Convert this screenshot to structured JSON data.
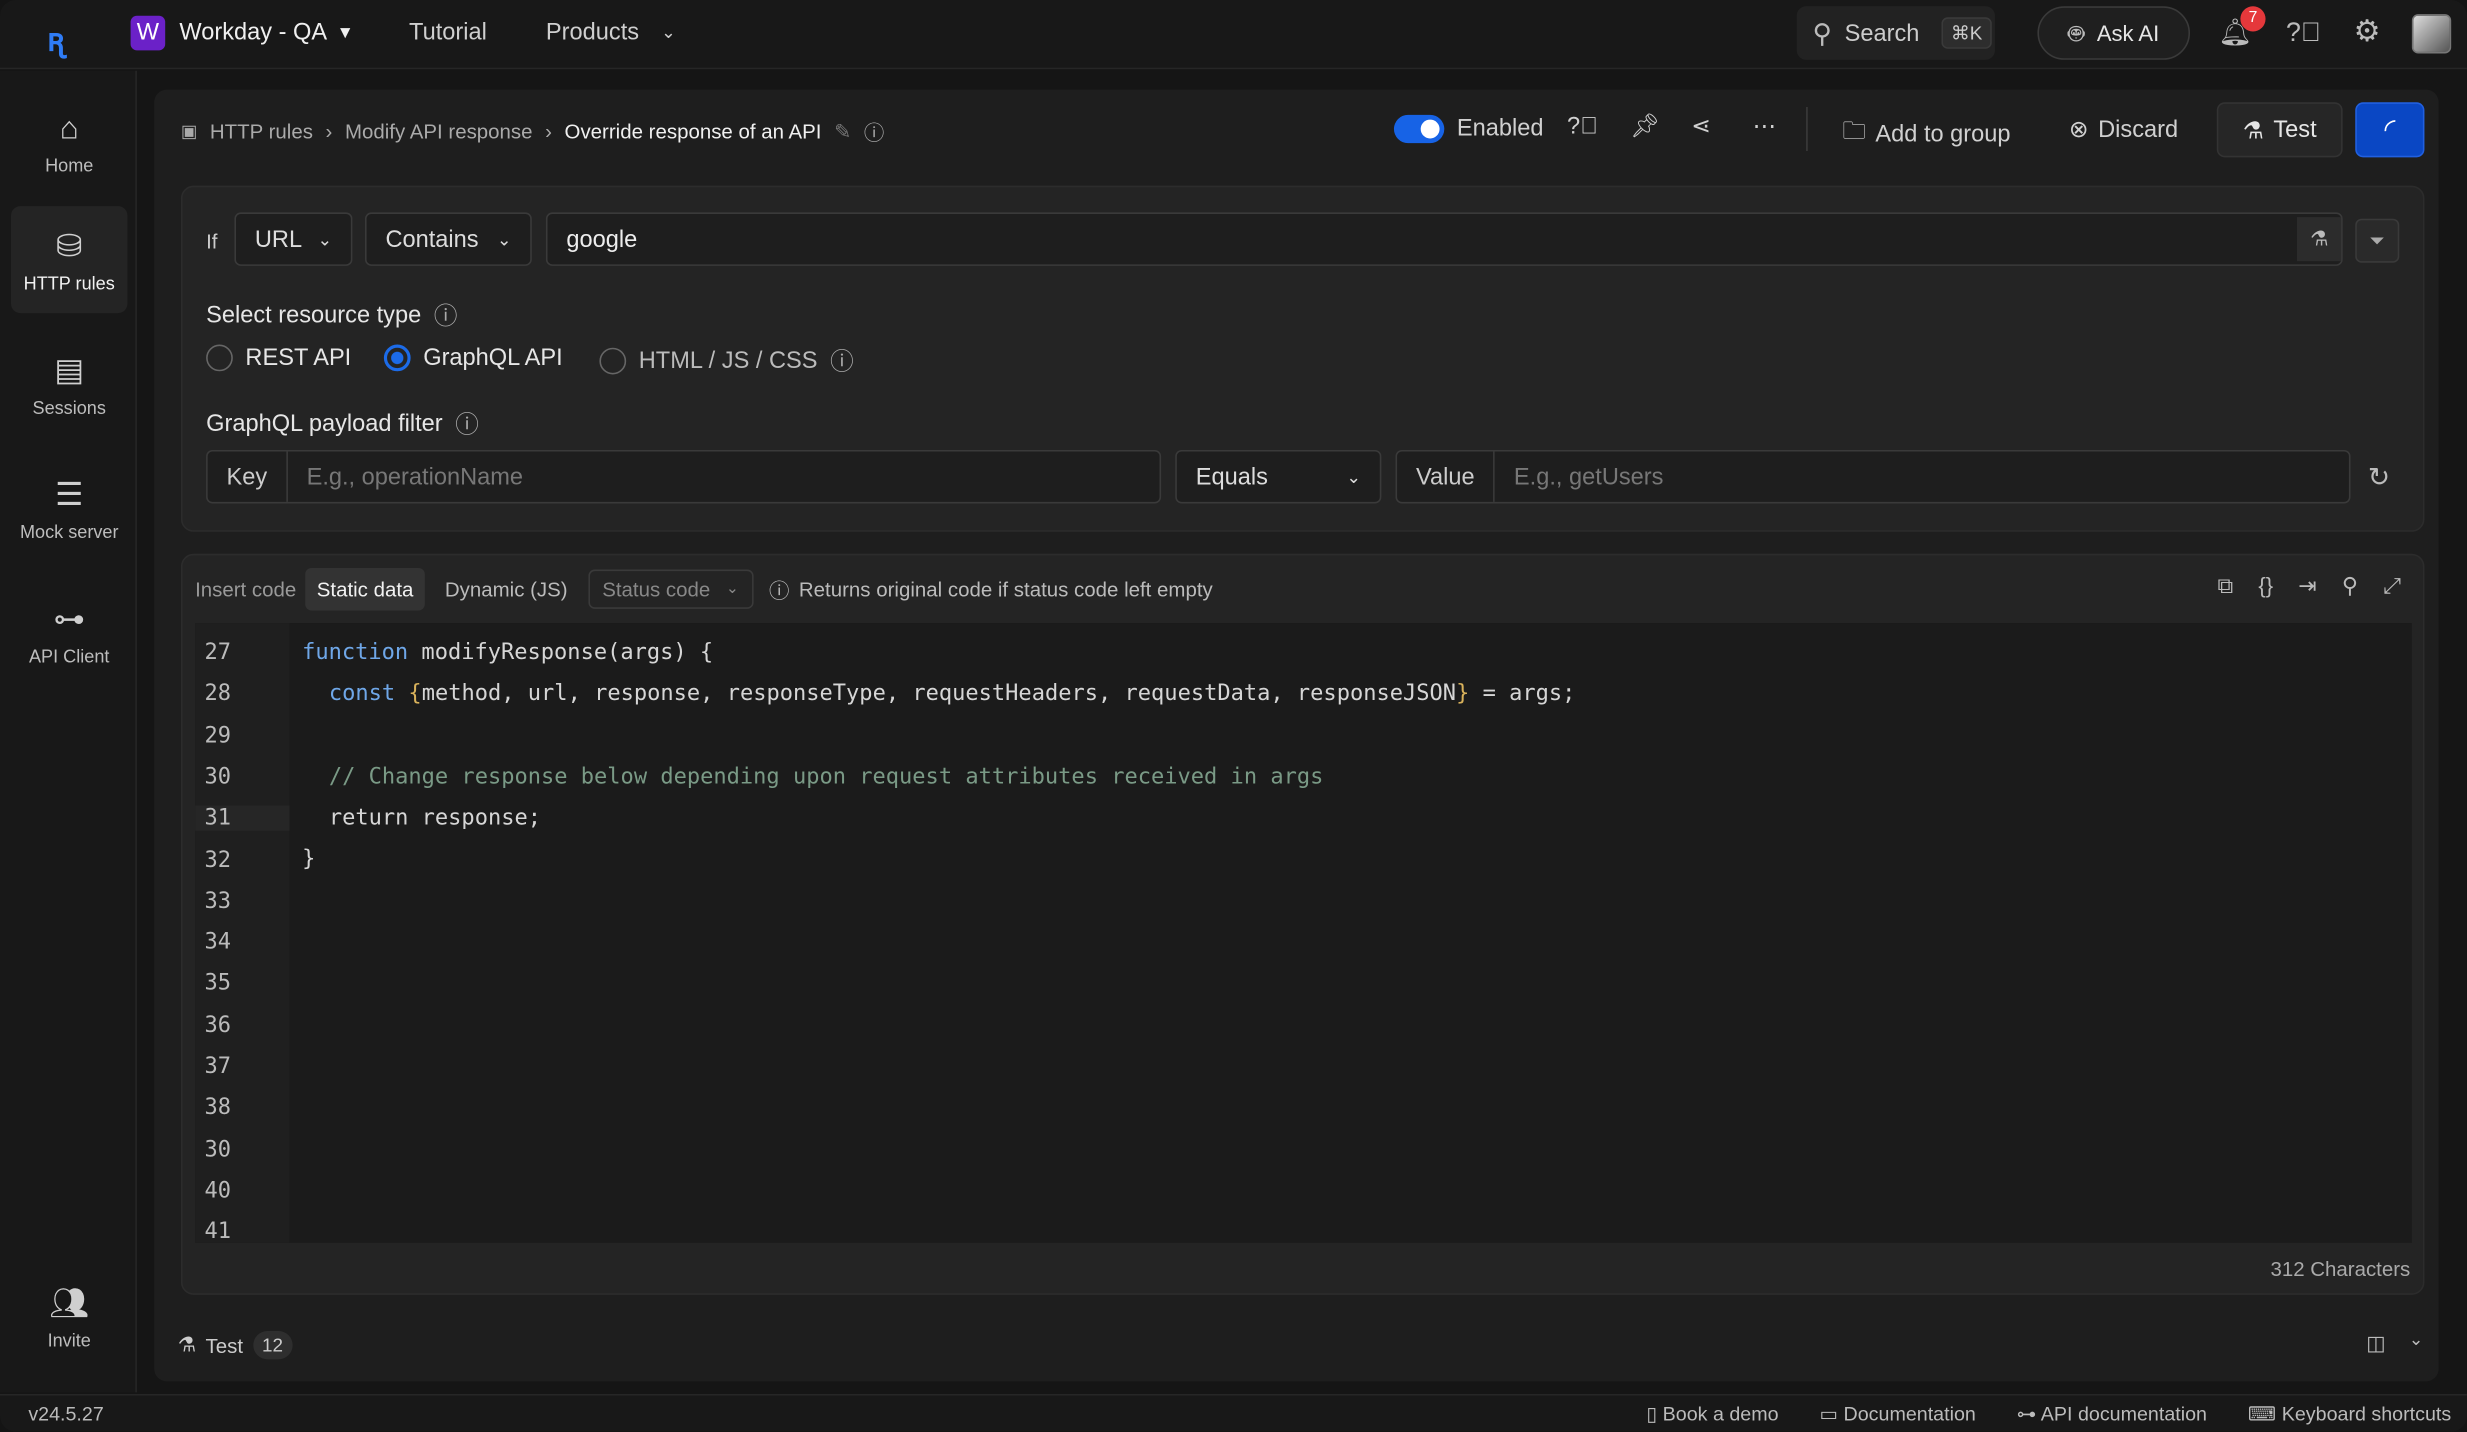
{
  "topbar": {
    "workspace_initial": "W",
    "workspace": "Workday - QA",
    "nav": [
      "Tutorial",
      "Products"
    ],
    "search": "Search",
    "search_kbd": "⌘K",
    "ask_ai": "Ask AI",
    "notifications": "7"
  },
  "sidebar": {
    "items": [
      {
        "label": "Home",
        "icon": "home"
      },
      {
        "label": "HTTP rules",
        "icon": "http-rules",
        "active": true
      },
      {
        "label": "Sessions",
        "icon": "sessions"
      },
      {
        "label": "Mock server",
        "icon": "server"
      },
      {
        "label": "API Client",
        "icon": "api-client"
      }
    ],
    "invite": "Invite"
  },
  "breadcrumb": [
    "HTTP rules",
    "Modify API response",
    "Override response of an API"
  ],
  "toolbar": {
    "enabled": "Enabled",
    "add_to_group": "Add to group",
    "discard": "Discard",
    "test": "Test",
    "accent": "#1763e6"
  },
  "condition": {
    "if": "If",
    "field": "URL",
    "operator": "Contains",
    "value": "google"
  },
  "resource": {
    "title": "Select resource type",
    "options": [
      "REST API",
      "GraphQL API",
      "HTML / JS / CSS"
    ],
    "selected": "GraphQL API"
  },
  "graphql": {
    "title": "GraphQL payload filter",
    "key_label": "Key",
    "key_placeholder": "E.g., operationName",
    "operator": "Equals",
    "value_label": "Value",
    "value_placeholder": "E.g., getUsers"
  },
  "code": {
    "insert": "Insert code",
    "tabs": [
      "Static data",
      "Dynamic (JS)"
    ],
    "active_tab": "Static data",
    "status_placeholder": "Status code",
    "hint": "Returns original code if status code left empty",
    "line_numbers": [
      "27",
      "28",
      "29",
      "30",
      "31",
      "32",
      "33",
      "34",
      "35",
      "36",
      "37",
      "38",
      "30",
      "40",
      "41"
    ],
    "lines": {
      "l27_kw": "function",
      "l27": " modifyResponse(args) {",
      "l28_kw": "const",
      "l28_ob": "{",
      "l28": "method, url, response, responseType, requestHeaders, requestData, responseJSON",
      "l28_cb": "}",
      "l28_end": " = args;",
      "l30": "// Change response below depending upon request attributes received in args",
      "l31": "return response;",
      "l32": "}"
    },
    "chars": "312 Characters"
  },
  "testbar": {
    "label": "Test",
    "count": "12"
  },
  "footer": {
    "version": "v24.5.27",
    "links": [
      "Book a demo",
      "Documentation",
      "API documentation",
      "Keyboard shortcuts"
    ]
  }
}
